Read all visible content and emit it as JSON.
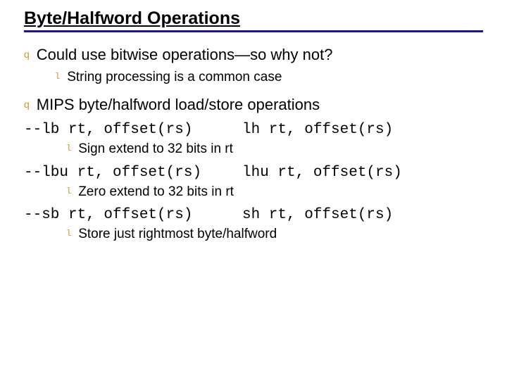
{
  "title": "Byte/Halfword Operations",
  "bullets": {
    "b1": "Could use bitwise operations—so why not?",
    "b1_sub": "String processing is a common case",
    "b2": "MIPS byte/halfword load/store operations"
  },
  "code": {
    "line1_left": "--lb rt, offset(rs)",
    "line1_right": "lh rt, offset(rs)",
    "line1_sub": "Sign extend to 32 bits in rt",
    "line2_left": "--lbu rt, offset(rs)",
    "line2_right": "lhu rt, offset(rs)",
    "line2_sub": "Zero extend to 32 bits in rt",
    "line3_left": "--sb rt, offset(rs)",
    "line3_right": "sh rt, offset(rs)",
    "line3_sub": "Store just rightmost byte/halfword"
  },
  "markers": {
    "q": "q",
    "l": "l"
  }
}
